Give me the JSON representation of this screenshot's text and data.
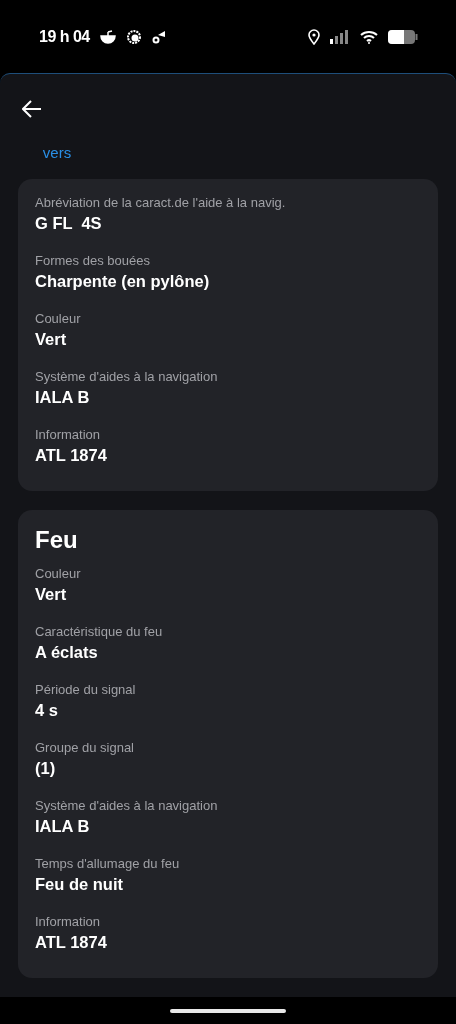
{
  "status_bar": {
    "time": "19 h 04"
  },
  "tabs": [
    {
      "label": "vers",
      "selected": true
    }
  ],
  "cards": [
    {
      "fields": [
        {
          "label": "Abréviation de la caract.de l'aide à la navig.",
          "value": "G FL  4S"
        },
        {
          "label": "Formes des bouées",
          "value": "Charpente (en pylône)"
        },
        {
          "label": "Couleur",
          "value": "Vert"
        },
        {
          "label": "Système d'aides à la navigation",
          "value": "IALA B"
        },
        {
          "label": "Information",
          "value": "ATL 1874"
        }
      ]
    },
    {
      "title": "Feu",
      "fields": [
        {
          "label": "Couleur",
          "value": "Vert"
        },
        {
          "label": "Caractéristique du feu",
          "value": "A éclats"
        },
        {
          "label": "Période du signal",
          "value": "4 s"
        },
        {
          "label": "Groupe du signal",
          "value": "(1)"
        },
        {
          "label": "Système d'aides à la navigation",
          "value": "IALA B"
        },
        {
          "label": "Temps d'allumage du feu",
          "value": "Feu de nuit"
        },
        {
          "label": "Information",
          "value": "ATL 1874"
        }
      ]
    }
  ]
}
